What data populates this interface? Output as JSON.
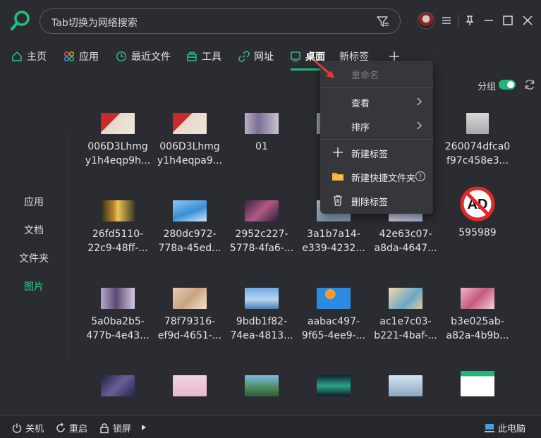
{
  "search": {
    "placeholder": "Tab切换为网络搜索"
  },
  "tabs": [
    {
      "label": "主页",
      "icon": "home-icon"
    },
    {
      "label": "应用",
      "icon": "apps-icon"
    },
    {
      "label": "最近文件",
      "icon": "clock-icon"
    },
    {
      "label": "工具",
      "icon": "toolbox-icon"
    },
    {
      "label": "网址",
      "icon": "link-icon"
    },
    {
      "label": "桌面",
      "icon": "desktop-icon",
      "active": true
    },
    {
      "label": "新标签",
      "icon": ""
    }
  ],
  "toolbar": {
    "group_label": "分组",
    "group_enabled": true
  },
  "sidebar": {
    "items": [
      "应用",
      "文档",
      "文件夹",
      "图片"
    ],
    "active": "图片"
  },
  "files": [
    [
      "006D3Lhmg",
      "y1h4eqp9h..."
    ],
    [
      "006D3Lhmg",
      "y1h4eqpa9..."
    ],
    [
      "01"
    ],
    [
      "260074dfca0",
      "f97c458e3..."
    ],
    [
      "26fd5110-",
      "22c9-48ff-..."
    ],
    [
      "280dc972-",
      "778a-45ed..."
    ],
    [
      "2952c227-",
      "5778-4fa6-..."
    ],
    [
      "3a1b7a14-",
      "e339-4232..."
    ],
    [
      "42e63c07-",
      "a8da-4647..."
    ],
    [
      "595989"
    ],
    [
      "5a0ba2b5-",
      "477b-4e43..."
    ],
    [
      "78f79316-",
      "ef9d-4651-..."
    ],
    [
      "9bdb1f82-",
      "74ea-4813..."
    ],
    [
      "aabac497-",
      "9f65-4ee9-..."
    ],
    [
      "ac1e7c03-",
      "b221-4baf-..."
    ],
    [
      "b3e025ab-",
      "a82a-4b9b..."
    ]
  ],
  "context_menu": {
    "rename": "重命名",
    "view": "查看",
    "sort": "排序",
    "new_tab": "新建标签",
    "new_shortcut_folder": "新建快捷文件夹",
    "delete_tab": "删除标签"
  },
  "bottom": {
    "shutdown": "关机",
    "restart": "重启",
    "lock": "锁屏",
    "this_pc": "此电脑"
  },
  "colors": {
    "accent": "#1fb67a",
    "background": "#2b2c31",
    "menu": "#36373c"
  }
}
